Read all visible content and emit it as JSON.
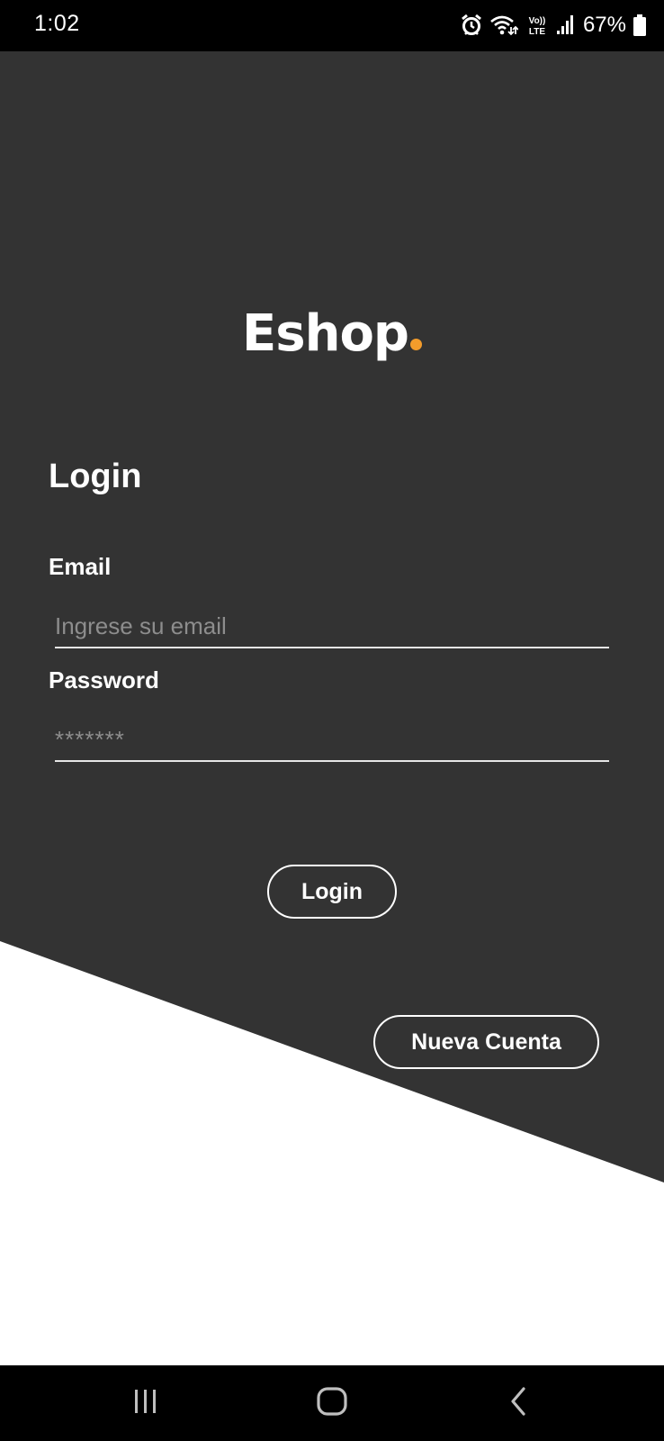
{
  "status_bar": {
    "time": "1:02",
    "battery_percent": "67%",
    "icons": [
      "alarm-icon",
      "wifi-icon",
      "volte-icon",
      "signal-icon",
      "battery-icon"
    ],
    "volte_label_top": "Vo))",
    "volte_label_bottom": "LTE"
  },
  "brand": {
    "name": "Eshop",
    "accent_color": "#f39c2b",
    "background_color": "#333333"
  },
  "form": {
    "title": "Login",
    "email_label": "Email",
    "email_placeholder": "Ingrese su email",
    "email_value": "",
    "password_label": "Password",
    "password_placeholder": "*******",
    "password_value": ""
  },
  "buttons": {
    "login": "Login",
    "new_account": "Nueva Cuenta"
  },
  "nav_bar": {
    "icons": [
      "recents-icon",
      "home-icon",
      "back-icon"
    ]
  }
}
